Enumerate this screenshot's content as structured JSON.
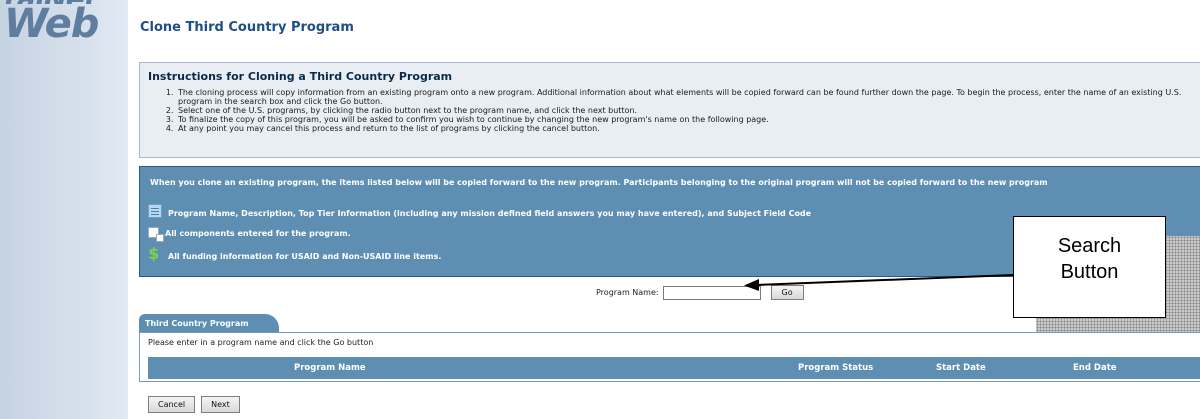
{
  "logo": {
    "top": "raiNet",
    "main": "Web"
  },
  "page_title": "Clone Third Country Program",
  "instructions": {
    "heading": "Instructions for Cloning a Third Country Program",
    "steps": [
      "The cloning process will copy information from an existing program onto a new program. Additional information about what elements will be copied forward can be found further down the page. To begin the process, enter the name of an existing U.S. program in the search box and click the Go button.",
      "Select one of the U.S. programs, by clicking the radio button next to the program name, and click the next button.",
      "To finalize the copy of this program, you will be asked to confirm you wish to continue by changing the new program's name on the following page.",
      "At any point you may cancel this process and return to the list of programs by clicking the cancel button."
    ]
  },
  "copy_panel": {
    "intro": "When you clone an existing program, the items listed below will be copied forward to the new program. Participants belonging to the original program will not be copied forward to the new program",
    "items": [
      {
        "icon": "table-icon",
        "text": "Program Name, Description, Top Tier Information (including any mission defined field answers you may have entered), and Subject Field Code"
      },
      {
        "icon": "components-icon",
        "text": "All components entered for the program."
      },
      {
        "icon": "dollar-icon",
        "text": "All funding information for USAID and Non-USAID line items."
      }
    ]
  },
  "search": {
    "label": "Program Name:",
    "value": "",
    "go_label": "Go"
  },
  "callout": {
    "line1": "Search",
    "line2": "Button"
  },
  "results": {
    "tab_label": "Third Country Program",
    "hint": "Please enter in a program name and click the Go button",
    "columns": [
      "Program Name",
      "Program Status",
      "Start Date",
      "End Date"
    ]
  },
  "actions": {
    "cancel_label": "Cancel",
    "next_label": "Next"
  }
}
